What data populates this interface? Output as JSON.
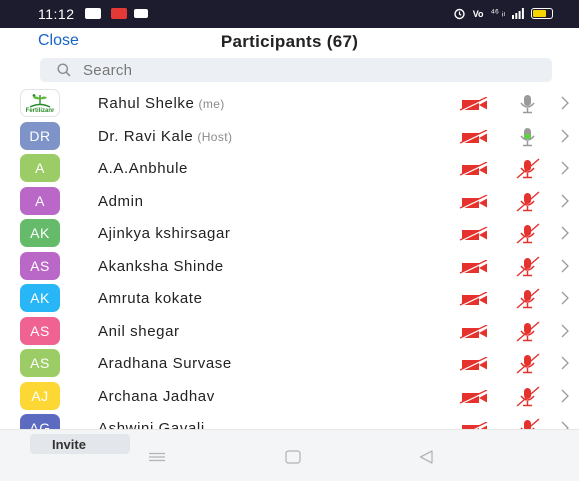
{
  "status_bar": {
    "time": "11:12",
    "right_text": "⁴⁶ ᵢₗ",
    "icons": [
      "gallery-icon",
      "record-icon",
      "video-icon",
      "alarm-icon",
      "volte-icon",
      "signal-icon",
      "battery-icon"
    ]
  },
  "header": {
    "close_label": "Close",
    "title": "Participants (67)"
  },
  "search": {
    "placeholder": "Search"
  },
  "colors": {
    "accent": "#1764c9",
    "video_off": "#e5322d",
    "mic_off": "#e5322d",
    "mic_on": "#5fcf47"
  },
  "participants": [
    {
      "name": "Rahul Shelke",
      "tag": "(me)",
      "initials": "",
      "avatar_type": "logo",
      "logo_text": "Fertilizanr",
      "color": "#ffffff",
      "video": "off",
      "mic": "idle"
    },
    {
      "name": "Dr. Ravi Kale",
      "tag": "(Host)",
      "initials": "DR",
      "avatar_type": "initials",
      "color": "#7e94c8",
      "video": "off",
      "mic": "on"
    },
    {
      "name": "A.A.Anbhule",
      "tag": "",
      "initials": "A",
      "avatar_type": "initials",
      "color": "#9ccc65",
      "video": "off",
      "mic": "muted"
    },
    {
      "name": "Admin",
      "tag": "",
      "initials": "A",
      "avatar_type": "initials",
      "color": "#ba68c8",
      "video": "off",
      "mic": "muted"
    },
    {
      "name": "Ajinkya kshirsagar",
      "tag": "",
      "initials": "AK",
      "avatar_type": "initials",
      "color": "#66bb6a",
      "video": "off",
      "mic": "muted"
    },
    {
      "name": "Akanksha Shinde",
      "tag": "",
      "initials": "AS",
      "avatar_type": "initials",
      "color": "#ba68c8",
      "video": "off",
      "mic": "muted"
    },
    {
      "name": "Amruta kokate",
      "tag": "",
      "initials": "AK",
      "avatar_type": "initials",
      "color": "#29b6f6",
      "video": "off",
      "mic": "muted"
    },
    {
      "name": "Anil shegar",
      "tag": "",
      "initials": "AS",
      "avatar_type": "initials",
      "color": "#f06292",
      "video": "off",
      "mic": "muted"
    },
    {
      "name": "Aradhana Survase",
      "tag": "",
      "initials": "AS",
      "avatar_type": "initials",
      "color": "#9ccc65",
      "video": "off",
      "mic": "muted"
    },
    {
      "name": "Archana Jadhav",
      "tag": "",
      "initials": "AJ",
      "avatar_type": "initials",
      "color": "#fdd835",
      "video": "off",
      "mic": "muted"
    },
    {
      "name": "Ashwini Gavali",
      "tag": "",
      "initials": "AG",
      "avatar_type": "initials",
      "color": "#5c6bc0",
      "video": "off",
      "mic": "muted"
    }
  ],
  "bottom": {
    "invite_label": "Invite"
  },
  "nav": {
    "icons": [
      "menu-nav-icon",
      "home-nav-icon",
      "back-nav-icon"
    ]
  }
}
